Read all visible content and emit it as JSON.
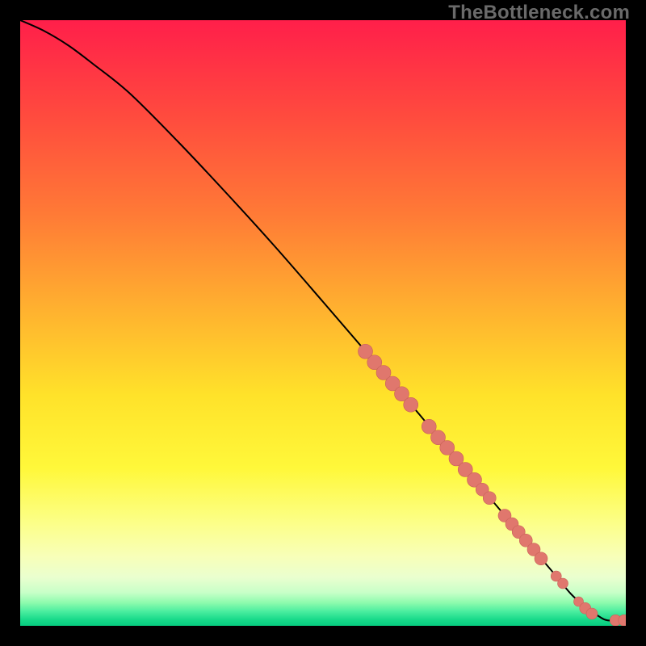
{
  "watermark": "TheBottleneck.com",
  "colors": {
    "page_bg": "#000000",
    "curve": "#000000",
    "dot_fill": "#e0776d",
    "dot_stroke": "#c86058",
    "gradient_stops": [
      {
        "offset": 0.0,
        "color": "#ff1f4a"
      },
      {
        "offset": 0.16,
        "color": "#ff4b3e"
      },
      {
        "offset": 0.32,
        "color": "#ff7a36"
      },
      {
        "offset": 0.48,
        "color": "#ffb22f"
      },
      {
        "offset": 0.62,
        "color": "#ffe22a"
      },
      {
        "offset": 0.74,
        "color": "#fff83a"
      },
      {
        "offset": 0.83,
        "color": "#fcff88"
      },
      {
        "offset": 0.885,
        "color": "#f8ffb8"
      },
      {
        "offset": 0.92,
        "color": "#eaffcf"
      },
      {
        "offset": 0.945,
        "color": "#c8ffc8"
      },
      {
        "offset": 0.962,
        "color": "#8dfbad"
      },
      {
        "offset": 0.976,
        "color": "#4ceea0"
      },
      {
        "offset": 0.99,
        "color": "#17d989"
      },
      {
        "offset": 1.0,
        "color": "#07cd80"
      }
    ]
  },
  "chart_data": {
    "type": "line",
    "title": "",
    "xlabel": "",
    "ylabel": "",
    "xlim": [
      0,
      100
    ],
    "ylim": [
      0,
      100
    ],
    "grid": false,
    "legend": "none",
    "note": "Axes are unlabeled in the source image; values are percent-of-plot estimates.",
    "series": [
      {
        "name": "curve",
        "kind": "line",
        "x": [
          0,
          4,
          8,
          12,
          18,
          26,
          34,
          42,
          50,
          58,
          66,
          72,
          78,
          84,
          88,
          91,
          93.5,
          95.5,
          97,
          100
        ],
        "y": [
          100,
          98.2,
          95.8,
          92.8,
          88.0,
          80.0,
          71.5,
          62.7,
          53.5,
          44.2,
          34.8,
          27.6,
          20.6,
          13.5,
          8.8,
          5.2,
          3.0,
          1.6,
          0.9,
          0.9
        ]
      },
      {
        "name": "markers-upper-run",
        "kind": "scatter",
        "x": [
          57.0,
          58.5,
          60.0,
          61.5,
          63.0,
          64.5
        ],
        "y": [
          45.3,
          43.5,
          41.8,
          40.0,
          38.3,
          36.5
        ],
        "r": [
          9,
          9,
          9,
          9,
          9,
          9
        ]
      },
      {
        "name": "markers-middle-run",
        "kind": "scatter",
        "x": [
          67.5,
          69.0,
          70.5,
          72.0,
          73.5,
          75.0,
          76.3,
          77.5
        ],
        "y": [
          32.9,
          31.1,
          29.4,
          27.6,
          25.8,
          24.1,
          22.5,
          21.1
        ],
        "r": [
          9,
          9,
          9,
          9,
          9,
          9,
          8,
          8
        ]
      },
      {
        "name": "markers-lower-run",
        "kind": "scatter",
        "x": [
          80.0,
          81.2,
          82.3,
          83.5,
          84.8,
          86.0
        ],
        "y": [
          18.2,
          16.8,
          15.5,
          14.1,
          12.6,
          11.1
        ],
        "r": [
          8,
          8,
          8,
          8,
          8,
          8
        ]
      },
      {
        "name": "markers-pair-a",
        "kind": "scatter",
        "x": [
          88.5,
          89.6
        ],
        "y": [
          8.2,
          7.0
        ],
        "r": [
          6.5,
          6.5
        ]
      },
      {
        "name": "markers-tail",
        "kind": "scatter",
        "x": [
          92.2,
          93.3,
          94.4
        ],
        "y": [
          4.0,
          2.9,
          2.0
        ],
        "r": [
          6,
          7,
          7
        ]
      },
      {
        "name": "markers-end-pair",
        "kind": "scatter",
        "x": [
          98.3,
          99.7
        ],
        "y": [
          0.9,
          0.9
        ],
        "r": [
          7,
          7
        ]
      }
    ]
  }
}
